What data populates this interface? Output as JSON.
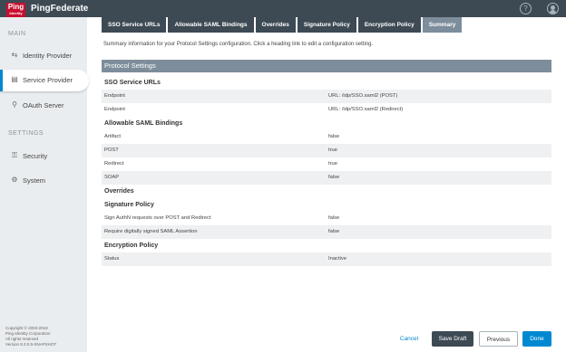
{
  "header": {
    "logo_text": "Ping",
    "logo_sub": "Identity",
    "brand": "PingFederate",
    "help_glyph": "?"
  },
  "tabs": [
    {
      "label": "SSO Service URLs"
    },
    {
      "label": "Allowable SAML Bindings"
    },
    {
      "label": "Overrides"
    },
    {
      "label": "Signature Policy"
    },
    {
      "label": "Encryption Policy"
    },
    {
      "label": "Summary"
    }
  ],
  "sidebar": {
    "main_label": "MAIN",
    "settings_label": "SETTINGS",
    "items": [
      {
        "label": "Identity Provider",
        "icon": "identity-provider-icon"
      },
      {
        "label": "Service Provider",
        "icon": "service-provider-icon"
      },
      {
        "label": "OAuth Server",
        "icon": "oauth-server-icon"
      },
      {
        "label": "Security",
        "icon": "security-icon"
      },
      {
        "label": "System",
        "icon": "system-icon"
      }
    ],
    "copyright": [
      "Copyright © 2003-2019",
      "Ping Identity Corporation",
      "All rights reserved",
      "Version 9.3.0.5-SNAPSHOT"
    ]
  },
  "main": {
    "summary_text": "Summary information for your Protocol Settings configuration. Click a heading link to edit a configuration setting.",
    "section_title": "Protocol Settings",
    "groups": [
      {
        "title": "SSO Service URLs",
        "rows": [
          {
            "key": "Endpoint",
            "value": "URL: /idp/SSO.saml2 (POST)"
          },
          {
            "key": "Endpoint",
            "value": "URL: /idp/SSO.saml2 (Redirect)"
          }
        ]
      },
      {
        "title": "Allowable SAML Bindings",
        "rows": [
          {
            "key": "Artifact",
            "value": "false"
          },
          {
            "key": "POST",
            "value": "true"
          },
          {
            "key": "Redirect",
            "value": "true"
          },
          {
            "key": "SOAP",
            "value": "false"
          }
        ]
      },
      {
        "title": "Overrides",
        "rows": []
      },
      {
        "title": "Signature Policy",
        "rows": [
          {
            "key": "Sign AuthN requests over POST and Redirect",
            "value": "false"
          },
          {
            "key": "Require digitally signed SAML Assertion",
            "value": "false"
          }
        ]
      },
      {
        "title": "Encryption Policy",
        "rows": [
          {
            "key": "Status",
            "value": "Inactive"
          }
        ]
      }
    ]
  },
  "buttons": {
    "cancel": "Cancel",
    "save_draft": "Save Draft",
    "previous": "Previous",
    "done": "Done"
  },
  "colors": {
    "accent": "#0089d0",
    "header": "#3d4a54",
    "section": "#7d8d9b"
  }
}
